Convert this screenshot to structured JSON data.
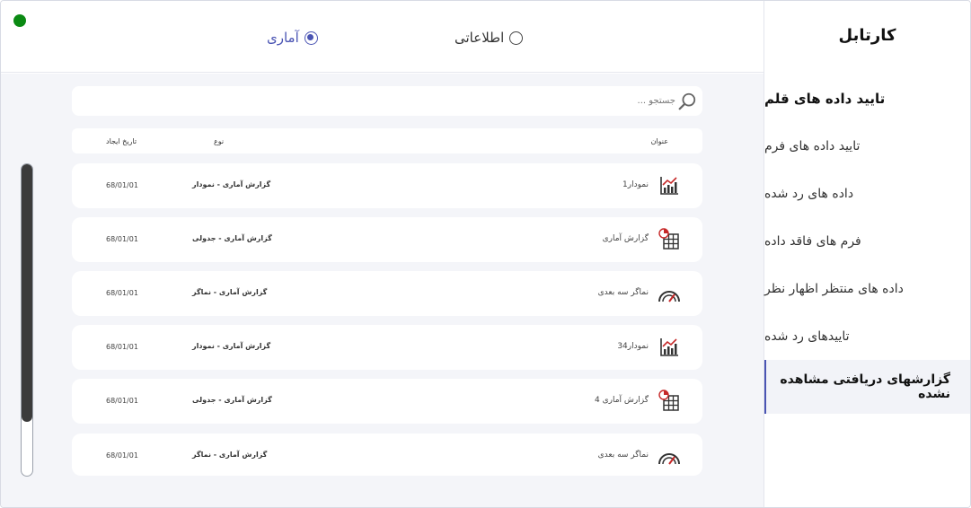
{
  "sidebar": {
    "title": "کارتابل",
    "items": [
      {
        "label": "تایید داده های قلم"
      },
      {
        "label": "تایید داده های فرم"
      },
      {
        "label": "داده های رد شده"
      },
      {
        "label": "فرم های فاقد داده"
      },
      {
        "label": "داده های منتظر اظهار نظر"
      },
      {
        "label": "تاییدهای رد شده"
      },
      {
        "label": "گزارشهای دریافتی مشاهده نشده"
      }
    ]
  },
  "topbar": {
    "radio_statistical": "آماری",
    "radio_informational": "اطلاعاتی",
    "selected": "آماری",
    "status_color": "#0b8a13"
  },
  "search": {
    "placeholder": "جستجو ..."
  },
  "table": {
    "headers": {
      "title": "عنوان",
      "type": "نوع",
      "created": "تاریخ ایجاد"
    },
    "rows": [
      {
        "title": "نمودار1",
        "type": "گزارش آماری - نمودار",
        "date": "68/01/01",
        "icon": "bar-chart-icon"
      },
      {
        "title": "گزارش آماری",
        "type": "گزارش آماری - جدولی",
        "date": "68/01/01",
        "icon": "table-report-icon"
      },
      {
        "title": "نماگر سه بعدی",
        "type": "گزارش آماری - نماگر",
        "date": "68/01/01",
        "icon": "gauge-icon"
      },
      {
        "title": "نمودار34",
        "type": "گزارش آماری - نمودار",
        "date": "68/01/01",
        "icon": "bar-chart-icon"
      },
      {
        "title": "گزارش آماری 4",
        "type": "گزارش آماری - جدولی",
        "date": "68/01/01",
        "icon": "table-report-icon"
      },
      {
        "title": "نماگر سه بعدی",
        "type": "گزارش آماری - نماگر",
        "date": "68/01/01",
        "icon": "gauge-icon"
      }
    ]
  },
  "colors": {
    "accent": "#4a54b3",
    "background": "#f4f5f9"
  }
}
